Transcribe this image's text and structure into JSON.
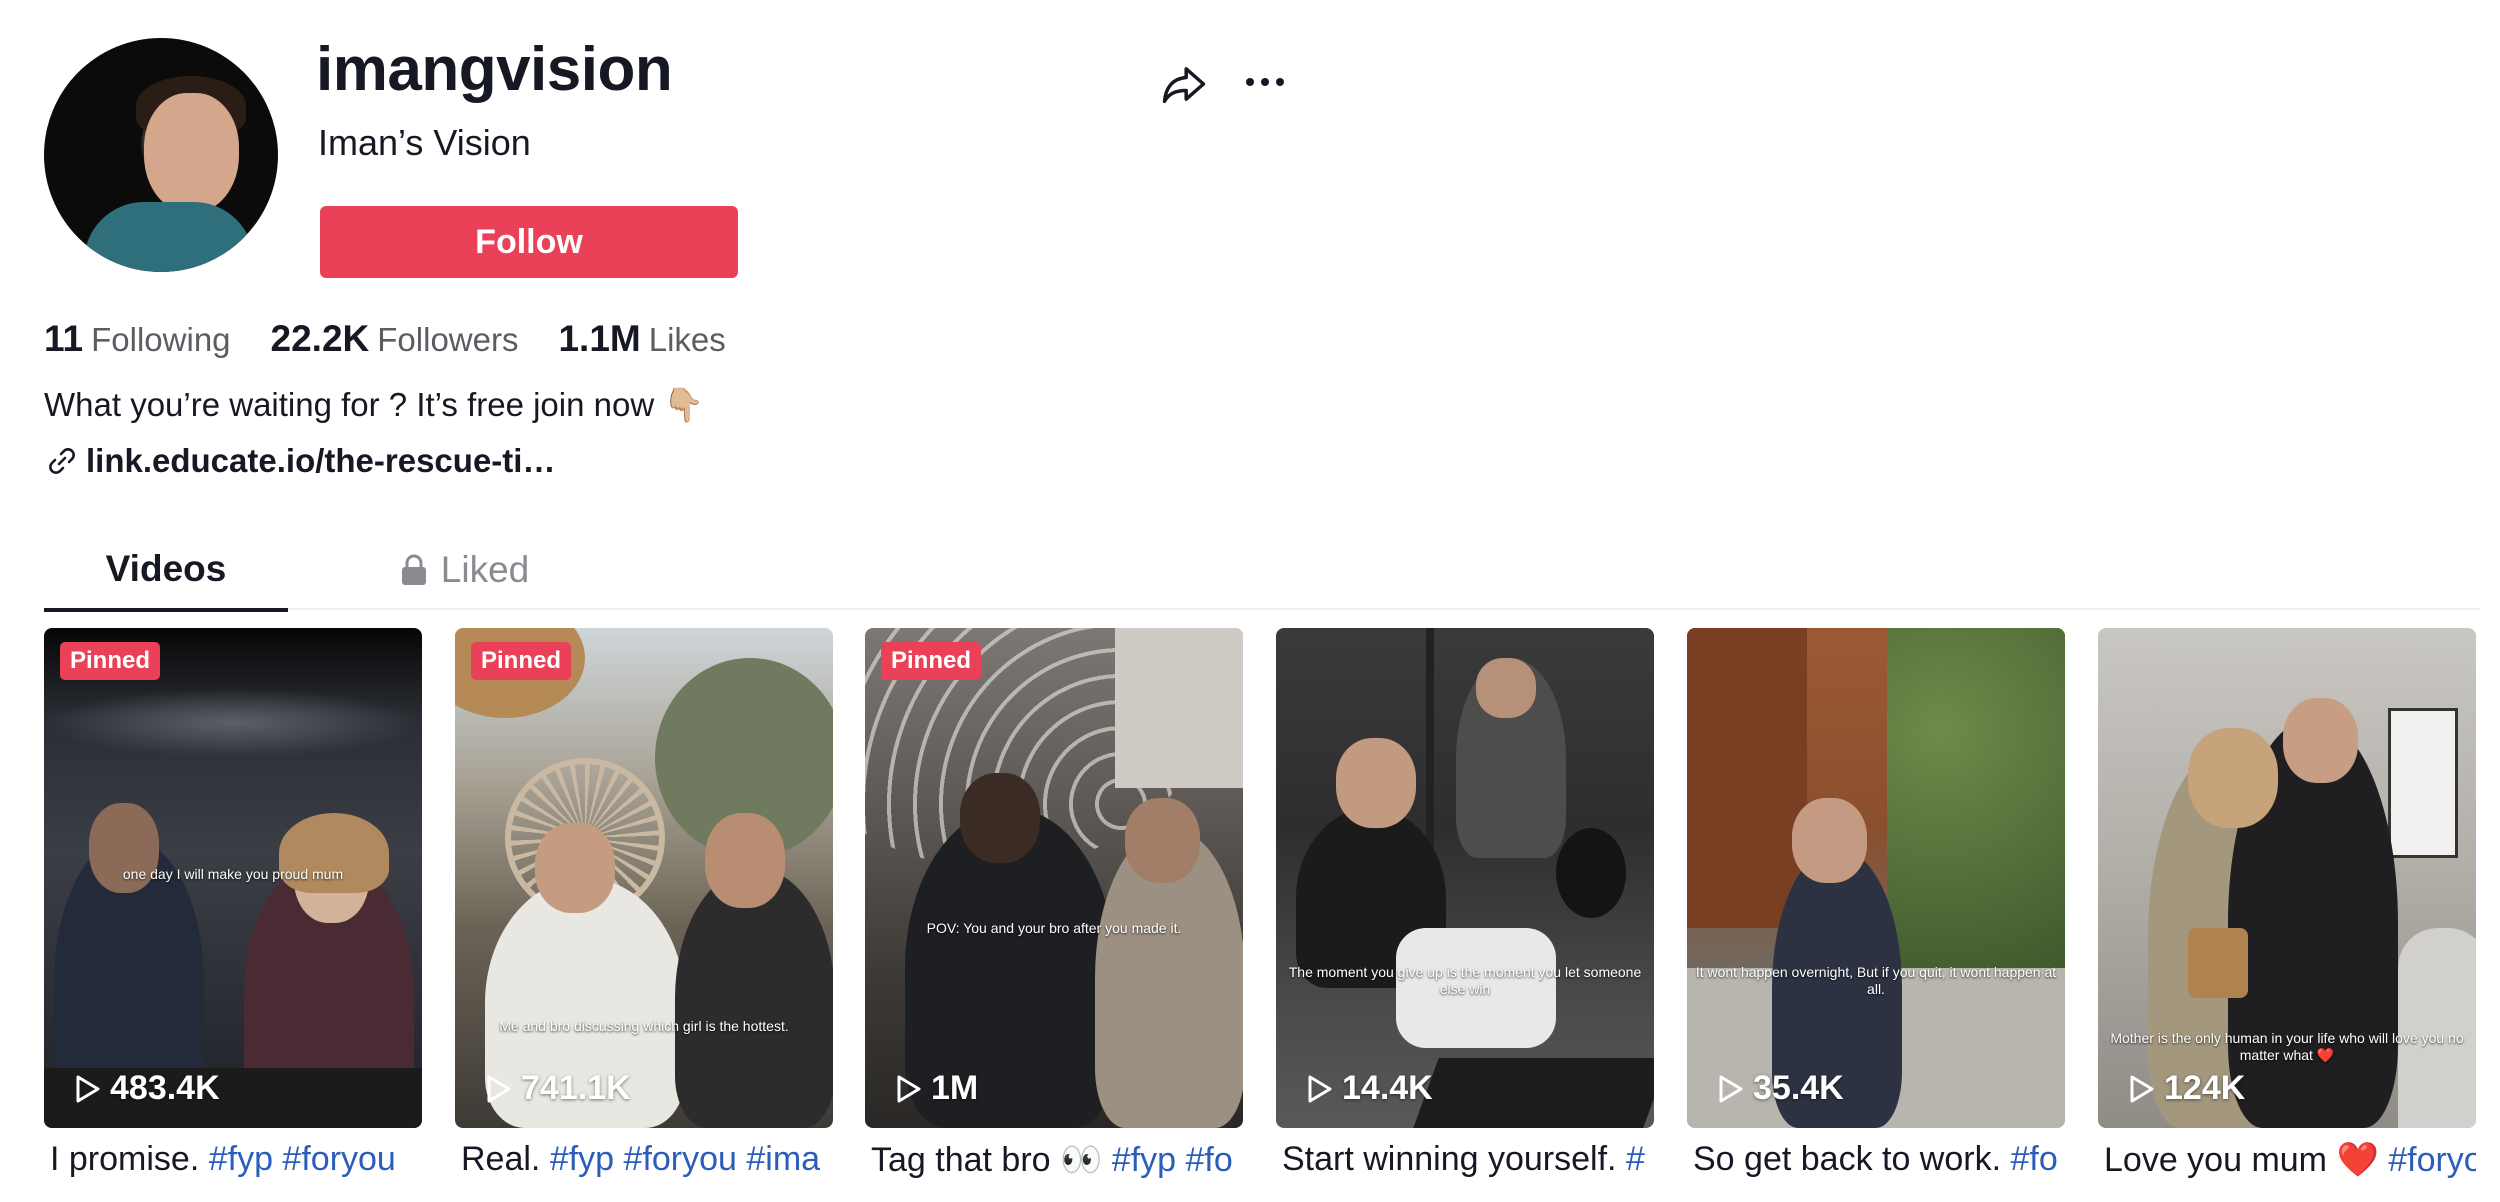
{
  "profile": {
    "username": "imangvision",
    "nickname": "Iman’s Vision",
    "follow_label": "Follow",
    "bio": "What you’re waiting for ? It’s free join now 👇🏼",
    "link": "link.educate.io/the-rescue-ti…"
  },
  "stats": [
    {
      "value": "11",
      "label": "Following"
    },
    {
      "value": "22.2K",
      "label": "Followers"
    },
    {
      "value": "1.1M",
      "label": "Likes"
    }
  ],
  "tabs": [
    {
      "label": "Videos",
      "active": true
    },
    {
      "label": "Liked",
      "locked": true
    }
  ],
  "colors": {
    "accent": "#ea4159",
    "hashtag": "#2b5db9",
    "text": "#161823"
  },
  "videos": [
    {
      "pinned": "Pinned",
      "plays": "483.4K",
      "caption_text": "I promise. ",
      "caption_tags": "#fyp #foryou",
      "overlay": "one day I will make you proud mum"
    },
    {
      "pinned": "Pinned",
      "plays": "741.1K",
      "caption_text": "Real. ",
      "caption_tags": "#fyp #foryou #ima",
      "overlay": "Me and bro discussing which girl is the hottest."
    },
    {
      "pinned": "Pinned",
      "plays": "1M",
      "caption_text": "Tag that bro 👀 ",
      "caption_tags": "#fyp #fo",
      "overlay": "POV: You and your bro after you made it."
    },
    {
      "pinned": "",
      "plays": "14.4K",
      "caption_text": "Start winning yourself. ",
      "caption_tags": "#",
      "overlay": "The moment you give up is the moment you let someone else win"
    },
    {
      "pinned": "",
      "plays": "35.4K",
      "caption_text": "So get back to work. ",
      "caption_tags": "#fo",
      "overlay": "It wont happen overnight, But if you quit, it wont happen at all."
    },
    {
      "pinned": "",
      "plays": "124K",
      "caption_text": "Love you mum ❤️ ",
      "caption_tags": "#foryo",
      "overlay": "Mother is the only human in your life who will love you no matter what ❤️"
    }
  ]
}
